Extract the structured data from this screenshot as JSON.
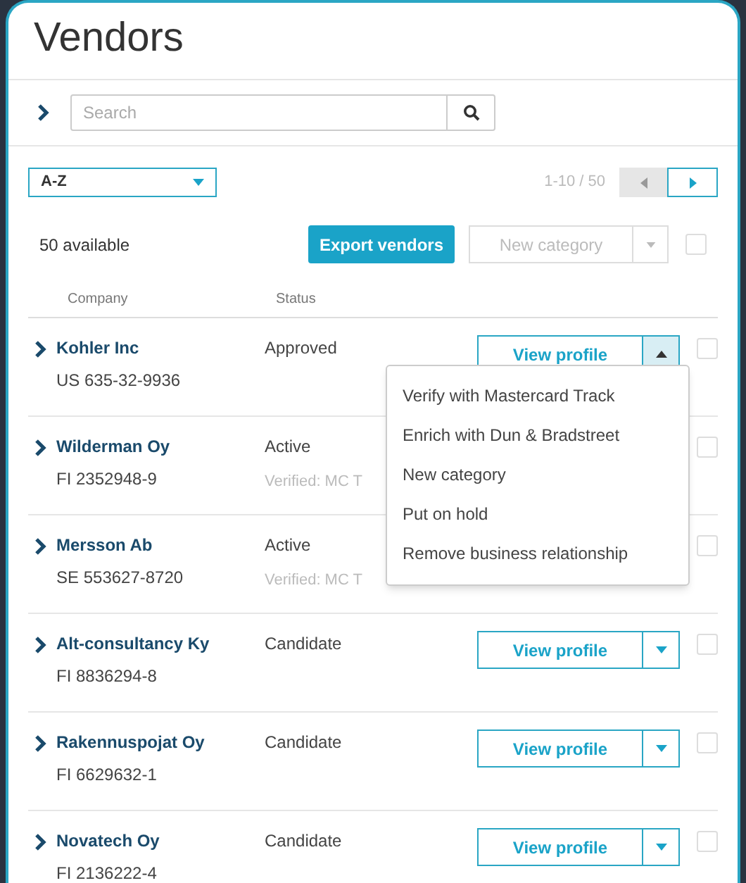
{
  "title": "Vendors",
  "search": {
    "placeholder": "Search"
  },
  "sort": {
    "value": "A-Z"
  },
  "pagination": {
    "range": "1-10 / 50",
    "prev_disabled": true,
    "next_disabled": false
  },
  "toolbar": {
    "count": "50 available",
    "export_label": "Export vendors",
    "category_label": "New category",
    "category_disabled": true,
    "select_all_checked": false
  },
  "columns": [
    "Company",
    "Status"
  ],
  "rows": [
    {
      "name": "Kohler Inc",
      "id": "US 635-32-9936",
      "status": "Approved",
      "action": "View profile",
      "expanded": true,
      "checked": false
    },
    {
      "name": "Wilderman Oy",
      "id": "FI 2352948-9",
      "status": "Active",
      "note": "Verified: MC T",
      "checked": false
    },
    {
      "name": "Mersson Ab",
      "id": "SE 553627-8720",
      "status": "Active",
      "note": "Verified: MC T",
      "checked": false
    },
    {
      "name": "Alt-consultancy Ky",
      "id": "FI 8836294-8",
      "status": "Candidate",
      "action": "View profile",
      "expanded": false,
      "checked": false
    },
    {
      "name": "Rakennuspojat Oy",
      "id": "FI 6629632-1",
      "status": "Candidate",
      "action": "View profile",
      "expanded": false,
      "checked": false
    },
    {
      "name": "Novatech Oy",
      "id": "FI 2136222-4",
      "status": "Candidate",
      "action": "View profile",
      "expanded": false,
      "checked": false
    }
  ],
  "menu": [
    "Verify with Mastercard Track",
    "Enrich with Dun & Bradstreet",
    "New category",
    "Put on hold",
    "Remove business relationship"
  ]
}
